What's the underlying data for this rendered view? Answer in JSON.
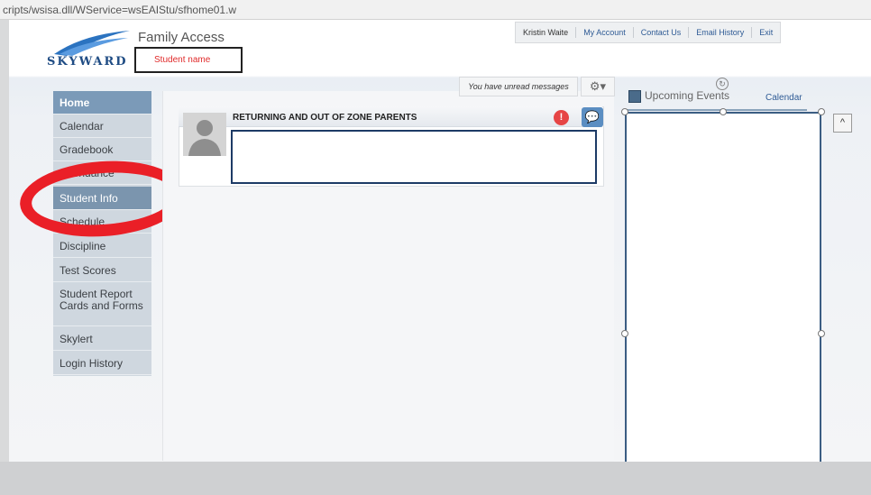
{
  "browser": {
    "url": "cripts/wsisa.dll/WService=wsEAIStu/sfhome01.w"
  },
  "brand": {
    "logo_text": "SKYWARD",
    "app_title": "Family Access",
    "student_name": "Student name"
  },
  "topnav": [
    {
      "label": "Kristin Waite"
    },
    {
      "label": "My Account"
    },
    {
      "label": "Contact Us"
    },
    {
      "label": "Email History"
    },
    {
      "label": "Exit"
    }
  ],
  "sidebar": {
    "items": [
      {
        "label": "Home"
      },
      {
        "label": "Calendar"
      },
      {
        "label": "Gradebook"
      },
      {
        "label": "Attendance"
      },
      {
        "label": "Student Info"
      },
      {
        "label": "Schedule"
      },
      {
        "label": "Discipline"
      },
      {
        "label": "Test Scores"
      },
      {
        "label": "Student Report Cards and Forms"
      },
      {
        "label": "Skylert"
      },
      {
        "label": "Login History"
      }
    ]
  },
  "messages": {
    "unread_text": "You have unread messages",
    "gear_icon": "gear-icon"
  },
  "card": {
    "title": "RETURNING AND OUT OF ZONE PARENTS",
    "alert": "!",
    "chat": "💬"
  },
  "events": {
    "title": "Upcoming Events",
    "calendar_link": "Calendar",
    "collapse": "^"
  },
  "colors": {
    "accent": "#7b9ab8",
    "annotation": "#ea1f27",
    "link": "#2f5b95"
  }
}
